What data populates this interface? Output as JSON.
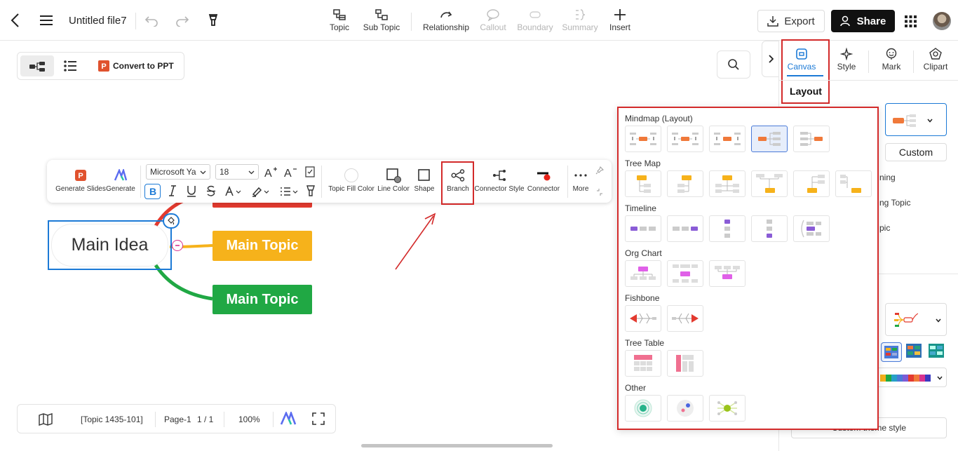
{
  "header": {
    "file_name": "Untitled file7",
    "tools": [
      {
        "label": "Topic"
      },
      {
        "label": "Sub Topic"
      },
      {
        "label": "Relationship"
      },
      {
        "label": "Callout"
      },
      {
        "label": "Boundary"
      },
      {
        "label": "Summary"
      },
      {
        "label": "Insert"
      }
    ],
    "export_label": "Export",
    "share_label": "Share"
  },
  "view": {
    "convert_label": "Convert to PPT"
  },
  "floating_toolbar": {
    "generate_slides": "Generate Slides",
    "generate": "Generate",
    "font_family": "Microsoft Ya",
    "font_size": "18",
    "topic_fill_color": "Topic Fill Color",
    "line_color": "Line Color",
    "shape": "Shape",
    "branch": "Branch",
    "connector_style": "Connector Style",
    "connector": "Connector",
    "more": "More"
  },
  "mindmap": {
    "main_idea": "Main Idea",
    "topics": [
      {
        "label": "Main Topic",
        "color": "#f6b21b"
      },
      {
        "label": "Main Topic",
        "color": "#20a844"
      }
    ]
  },
  "right_panel": {
    "tabs": [
      {
        "label": "Canvas"
      },
      {
        "label": "Style"
      },
      {
        "label": "Mark"
      },
      {
        "label": "Clipart"
      }
    ],
    "layout_heading": "Layout",
    "custom_label": "Custom",
    "partial_texts": [
      "ning",
      "ng Topic",
      "pic"
    ],
    "custom_theme_label": "Custom theme style"
  },
  "layout_dropdown": {
    "sections": [
      {
        "title": "Mindmap (Layout)",
        "count": 5,
        "active_index": 3
      },
      {
        "title": "Tree Map",
        "count": 6
      },
      {
        "title": "Timeline",
        "count": 5
      },
      {
        "title": "Org Chart",
        "count": 3
      },
      {
        "title": "Fishbone",
        "count": 2
      },
      {
        "title": "Tree Table",
        "count": 2
      },
      {
        "title": "Other",
        "count": 3
      }
    ]
  },
  "bottom_bar": {
    "topic_count": "[Topic 1435-101]",
    "page": "Page-1",
    "page_count": "1 / 1",
    "zoom": "100%"
  },
  "colors": {
    "accent_blue": "#1c7ad6",
    "highlight_red": "#d32a2a",
    "orange": "#f0793a",
    "yellow": "#f6b21b",
    "green": "#20a844"
  }
}
